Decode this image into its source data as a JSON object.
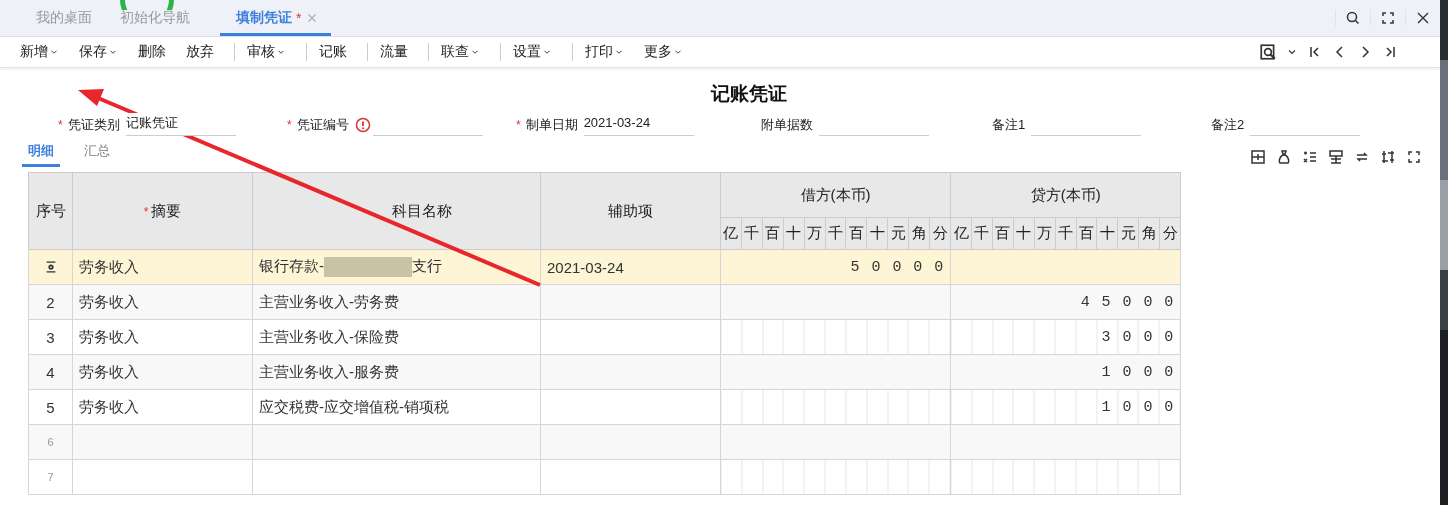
{
  "tabs": [
    {
      "label": "我的桌面",
      "selected": false,
      "closable": false
    },
    {
      "label": "初始化导航",
      "selected": false,
      "closable": false
    },
    {
      "label": "填制凭证",
      "selected": true,
      "modified_mark": "*",
      "closable": true
    }
  ],
  "toolbar": [
    {
      "label": "新增",
      "dropdown": true,
      "divider_before": false
    },
    {
      "label": "保存",
      "dropdown": true,
      "divider_before": false
    },
    {
      "label": "删除",
      "dropdown": false,
      "divider_before": false
    },
    {
      "label": "放弃",
      "dropdown": false,
      "divider_before": false
    },
    {
      "label": "审核",
      "dropdown": true,
      "divider_before": true
    },
    {
      "label": "记账",
      "dropdown": false,
      "divider_before": true
    },
    {
      "label": "流量",
      "dropdown": false,
      "divider_before": true
    },
    {
      "label": "联查",
      "dropdown": true,
      "divider_before": true
    },
    {
      "label": "设置",
      "dropdown": true,
      "divider_before": true
    },
    {
      "label": "打印",
      "dropdown": true,
      "divider_before": true
    },
    {
      "label": "更多",
      "dropdown": true,
      "divider_before": false
    }
  ],
  "title": "记账凭证",
  "fields": [
    {
      "required_mark": "*",
      "label": "凭证类别",
      "error": false,
      "value": "记账凭证"
    },
    {
      "required_mark": "*",
      "label": "凭证编号",
      "error": true
    },
    {
      "required_mark": "*",
      "label": "制单日期",
      "error": false,
      "value": "2021-03-24"
    },
    {
      "label": "附单据数",
      "error": false
    },
    {
      "label": "备注1",
      "error": false
    },
    {
      "label": "备注2",
      "error": false
    }
  ],
  "subtabs": [
    {
      "label": "明细",
      "selected": true
    },
    {
      "label": "汇总",
      "selected": false
    }
  ],
  "table": {
    "columns": [
      {
        "label": "序号"
      },
      {
        "required_mark": "*",
        "label": "摘要"
      },
      {
        "label": "科目名称"
      },
      {
        "label": "辅助项"
      }
    ],
    "debit_header": "借方(本币)",
    "credit_header": "贷方(本币)",
    "debit_units": [
      "亿",
      "千",
      "百",
      "十",
      "万",
      "千",
      "百",
      "十",
      "元",
      "角",
      "分"
    ],
    "credit_units": [
      "亿",
      "千",
      "百",
      "十",
      "万",
      "千",
      "百",
      "十",
      "元",
      "角",
      "分"
    ],
    "rows": [
      {
        "selected": true,
        "empty": false,
        "summary": "劳务收入",
        "account": "银行存款-",
        "account_redacted": true,
        "account_after": "支行",
        "aux": "2021-03-24",
        "debit": "50000"
      },
      {
        "selected": false,
        "empty": false,
        "seq": "2",
        "summary": "劳务收入",
        "account": "主营业务收入-劳务费",
        "credit": "45000"
      },
      {
        "selected": false,
        "empty": false,
        "seq": "3",
        "summary": "劳务收入",
        "account": "主营业务收入-保险费",
        "credit": "3000"
      },
      {
        "selected": false,
        "empty": false,
        "seq": "4",
        "summary": "劳务收入",
        "account": "主营业务收入-服务费",
        "credit": "1000"
      },
      {
        "selected": false,
        "empty": false,
        "seq": "5",
        "summary": "劳务收入",
        "account": "应交税费-应交增值税-销项税",
        "credit": "1000"
      },
      {
        "selected": false,
        "empty": true,
        "seq": "6"
      },
      {
        "selected": false,
        "empty": true,
        "seq": "7"
      }
    ]
  }
}
